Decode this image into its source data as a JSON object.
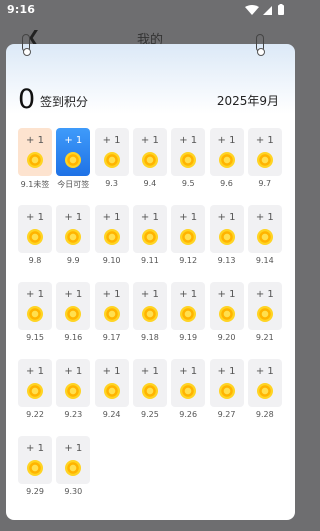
{
  "status": {
    "time": "9:16"
  },
  "header": {
    "title": "我的"
  },
  "summary": {
    "points": "0",
    "points_label": "签到积分",
    "month": "2025年9月"
  },
  "reward_text": "+ 1",
  "days": [
    {
      "label": "9.1未签",
      "state": "signed"
    },
    {
      "label": "今日可签",
      "state": "today"
    },
    {
      "label": "9.3",
      "state": "future"
    },
    {
      "label": "9.4",
      "state": "future"
    },
    {
      "label": "9.5",
      "state": "future"
    },
    {
      "label": "9.6",
      "state": "future"
    },
    {
      "label": "9.7",
      "state": "future"
    },
    {
      "label": "9.8",
      "state": "future"
    },
    {
      "label": "9.9",
      "state": "future"
    },
    {
      "label": "9.10",
      "state": "future"
    },
    {
      "label": "9.11",
      "state": "future"
    },
    {
      "label": "9.12",
      "state": "future"
    },
    {
      "label": "9.13",
      "state": "future"
    },
    {
      "label": "9.14",
      "state": "future"
    },
    {
      "label": "9.15",
      "state": "future"
    },
    {
      "label": "9.16",
      "state": "future"
    },
    {
      "label": "9.17",
      "state": "future"
    },
    {
      "label": "9.18",
      "state": "future"
    },
    {
      "label": "9.19",
      "state": "future"
    },
    {
      "label": "9.20",
      "state": "future"
    },
    {
      "label": "9.21",
      "state": "future"
    },
    {
      "label": "9.22",
      "state": "future"
    },
    {
      "label": "9.23",
      "state": "future"
    },
    {
      "label": "9.24",
      "state": "future"
    },
    {
      "label": "9.25",
      "state": "future"
    },
    {
      "label": "9.26",
      "state": "future"
    },
    {
      "label": "9.27",
      "state": "future"
    },
    {
      "label": "9.28",
      "state": "future"
    },
    {
      "label": "9.29",
      "state": "future"
    },
    {
      "label": "9.30",
      "state": "future"
    }
  ],
  "colors": {
    "signed": "#fde3cf",
    "today": "#2f86f2",
    "future": "#f1f1f3",
    "coin": "#ffc107"
  },
  "icons": {
    "back": "back-arrow-icon",
    "wifi": "wifi-icon",
    "signal": "signal-icon",
    "battery": "battery-icon",
    "coin": "coin-icon"
  }
}
